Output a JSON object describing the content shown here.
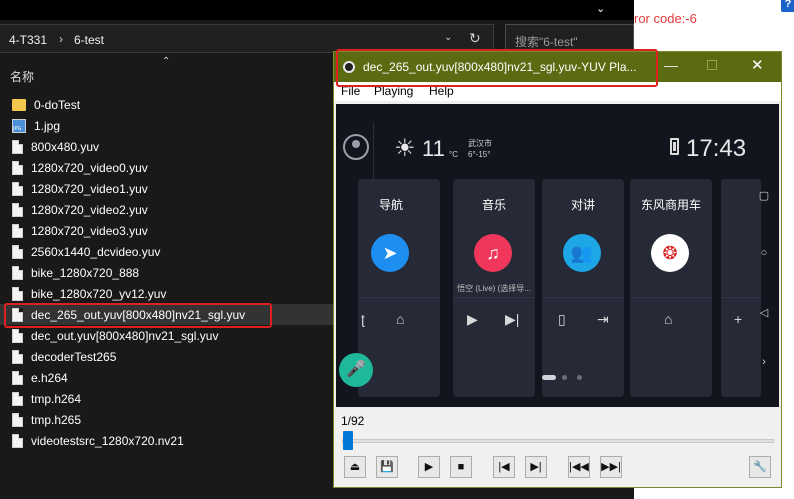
{
  "explorer": {
    "breadcrumb": [
      "4-T331",
      "6-test"
    ],
    "search_placeholder": "搜索\"6-test\"",
    "column_header": "名称",
    "files": [
      {
        "name": "0-doTest",
        "icon": "folder-icon"
      },
      {
        "name": "1.jpg",
        "icon": "image-file-icon"
      },
      {
        "name": "800x480.yuv",
        "icon": "file-icon"
      },
      {
        "name": "1280x720_video0.yuv",
        "icon": "file-icon"
      },
      {
        "name": "1280x720_video1.yuv",
        "icon": "file-icon"
      },
      {
        "name": "1280x720_video2.yuv",
        "icon": "file-icon"
      },
      {
        "name": "1280x720_video3.yuv",
        "icon": "file-icon"
      },
      {
        "name": "2560x1440_dcvideo.yuv",
        "icon": "file-icon"
      },
      {
        "name": "bike_1280x720_888",
        "icon": "file-icon"
      },
      {
        "name": "bike_1280x720_yv12.yuv",
        "icon": "file-icon"
      },
      {
        "name": "dec_265_out.yuv[800x480]nv21_sgl.yuv",
        "icon": "file-icon",
        "selected": true
      },
      {
        "name": "dec_out.yuv[800x480]nv21_sgl.yuv",
        "icon": "file-icon"
      },
      {
        "name": "decoderTest265",
        "icon": "file-icon"
      },
      {
        "name": "e.h264",
        "icon": "file-icon"
      },
      {
        "name": "tmp.h264",
        "icon": "file-icon"
      },
      {
        "name": "tmp.h265",
        "icon": "file-icon"
      },
      {
        "name": "videotestsrc_1280x720.nv21",
        "icon": "file-icon"
      }
    ]
  },
  "background_text": {
    "error": "ror code:-6",
    "help_badge": "?"
  },
  "player": {
    "title": "dec_265_out.yuv[800x480]nv21_sgl.yuv-YUV Pla...",
    "menu": [
      "File",
      "Playing",
      "Help"
    ],
    "frame_label": "1/92",
    "frame_current": 1,
    "frame_total": 92,
    "video": {
      "temperature": "11",
      "temp_unit": "°C",
      "city": "武汉市",
      "temp_range": "6°-15°",
      "time": "17:43",
      "cards": [
        {
          "title": "导航",
          "icon": "navigation-icon",
          "color": "#1f8ef1"
        },
        {
          "title": "音乐",
          "icon": "music-icon",
          "color": "#f0365a",
          "sub": "悟空 (Live) (选择导..."
        },
        {
          "title": "对讲",
          "icon": "intercom-icon",
          "color": "#1ea7e6"
        },
        {
          "title": "东风商用车",
          "icon": "dongfeng-logo-icon",
          "color": "#ffffff"
        }
      ]
    },
    "buttons": [
      "eject-icon",
      "save-icon",
      "play-icon",
      "stop-icon",
      "prev-frame-icon",
      "next-frame-icon",
      "rewind-icon",
      "fast-forward-icon",
      "settings-wrench-icon"
    ]
  },
  "annotations": {
    "highlight_color": "#e02020"
  }
}
